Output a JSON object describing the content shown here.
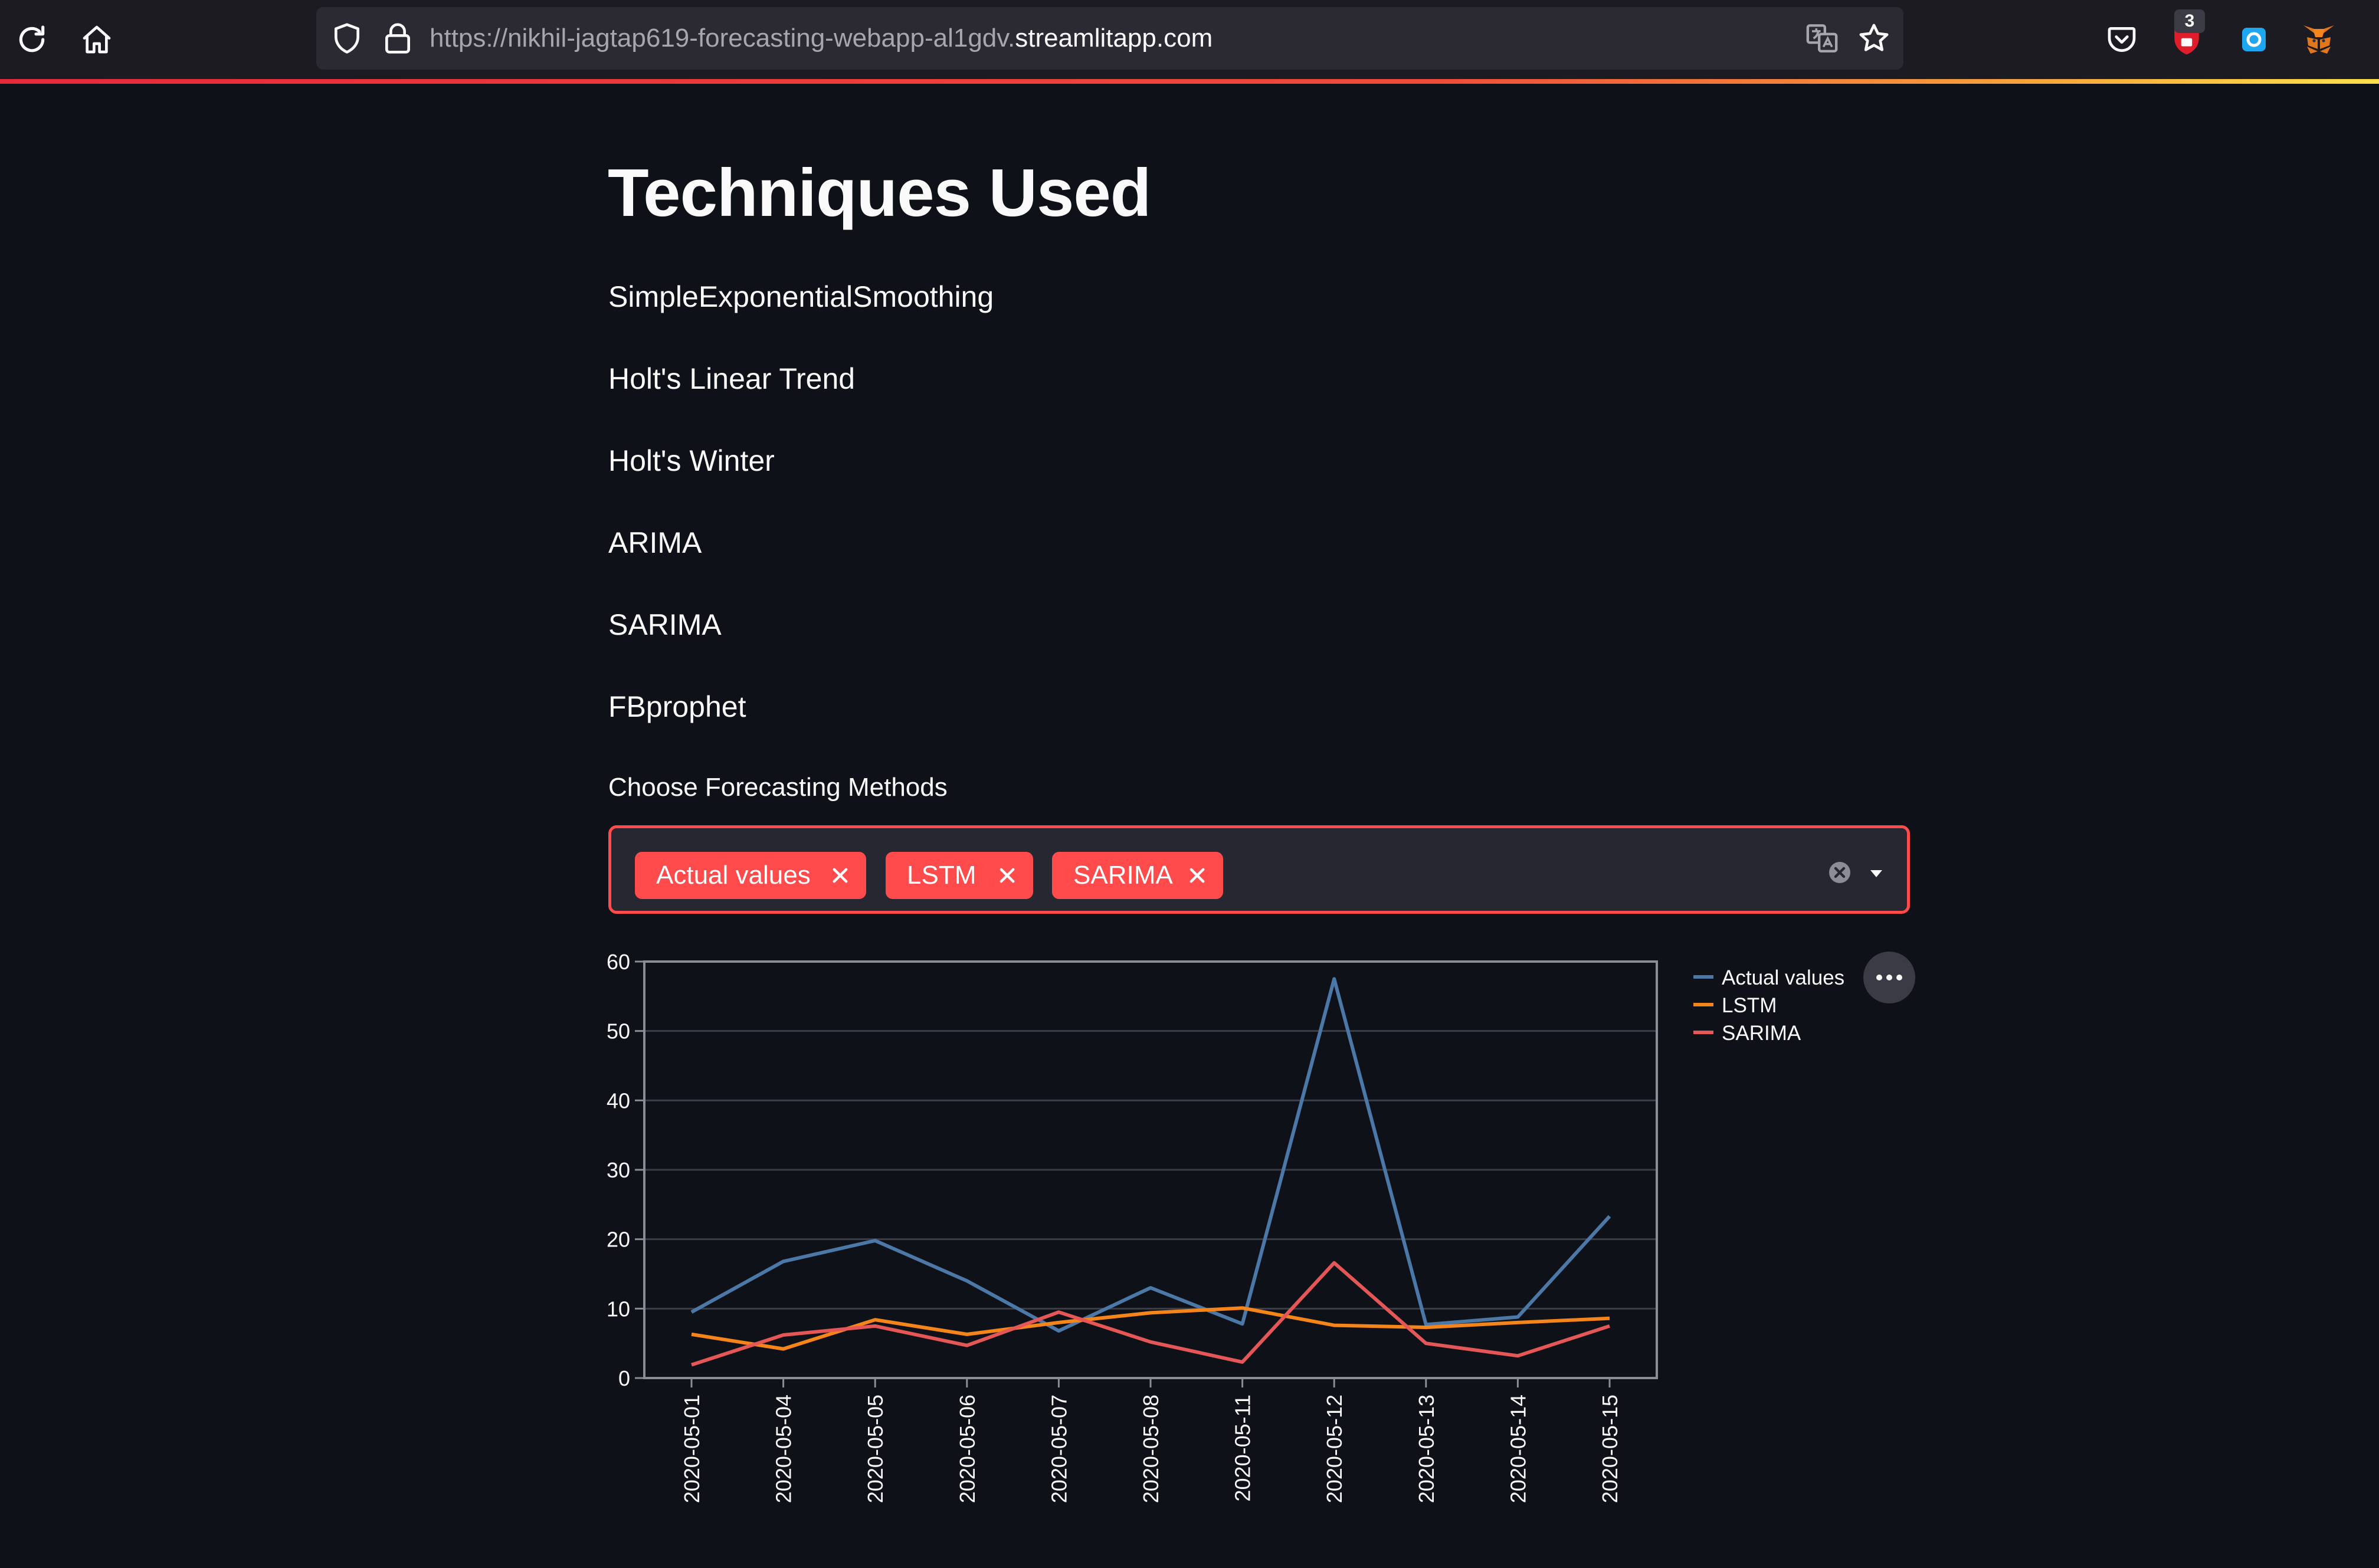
{
  "browser": {
    "url_prefix": "https://nikhil-jagtap619-forecasting-webapp-al1gdv.",
    "url_host": "streamlitapp.com",
    "extension_badge": "3",
    "icons": [
      "reload-icon",
      "home-icon",
      "shield-icon",
      "lock-icon",
      "translate-icon",
      "star-icon",
      "pocket-icon",
      "ublock-icon",
      "extension-icon",
      "metamask-icon"
    ]
  },
  "page": {
    "title": "Techniques Used",
    "techniques": [
      "SimpleExponentialSmoothing",
      "Holt's Linear Trend",
      "Holt's Winter",
      "ARIMA",
      "SARIMA",
      "FBprophet"
    ],
    "multiselect": {
      "label": "Choose Forecasting Methods",
      "selected": [
        "Actual values",
        "LSTM",
        "SARIMA"
      ]
    }
  },
  "colors": {
    "background": "#0e1117",
    "accent": "#ff4b4b",
    "series": [
      "#4c78a8",
      "#f58518",
      "#e45756"
    ]
  },
  "chart_data": {
    "type": "line",
    "title": "",
    "xlabel": "",
    "ylabel": "",
    "ylim": [
      0,
      60
    ],
    "yticks": [
      0,
      10,
      20,
      30,
      40,
      50,
      60
    ],
    "grid": true,
    "legend_position": "top-right",
    "x": [
      "2020-05-01",
      "2020-05-04",
      "2020-05-05",
      "2020-05-06",
      "2020-05-07",
      "2020-05-08",
      "2020-05-11",
      "2020-05-12",
      "2020-05-13",
      "2020-05-14",
      "2020-05-15"
    ],
    "series": [
      {
        "name": "Actual values",
        "values": [
          9.5,
          16.8,
          19.8,
          14.0,
          6.8,
          13.0,
          7.8,
          57.5,
          7.7,
          8.8,
          23.3
        ]
      },
      {
        "name": "LSTM",
        "values": [
          6.3,
          4.2,
          8.4,
          6.3,
          8.0,
          9.4,
          10.1,
          7.6,
          7.3,
          8.0,
          8.6
        ]
      },
      {
        "name": "SARIMA",
        "values": [
          1.9,
          6.2,
          7.5,
          4.7,
          9.5,
          5.2,
          2.3,
          16.6,
          5.0,
          3.2,
          7.5
        ]
      }
    ]
  }
}
